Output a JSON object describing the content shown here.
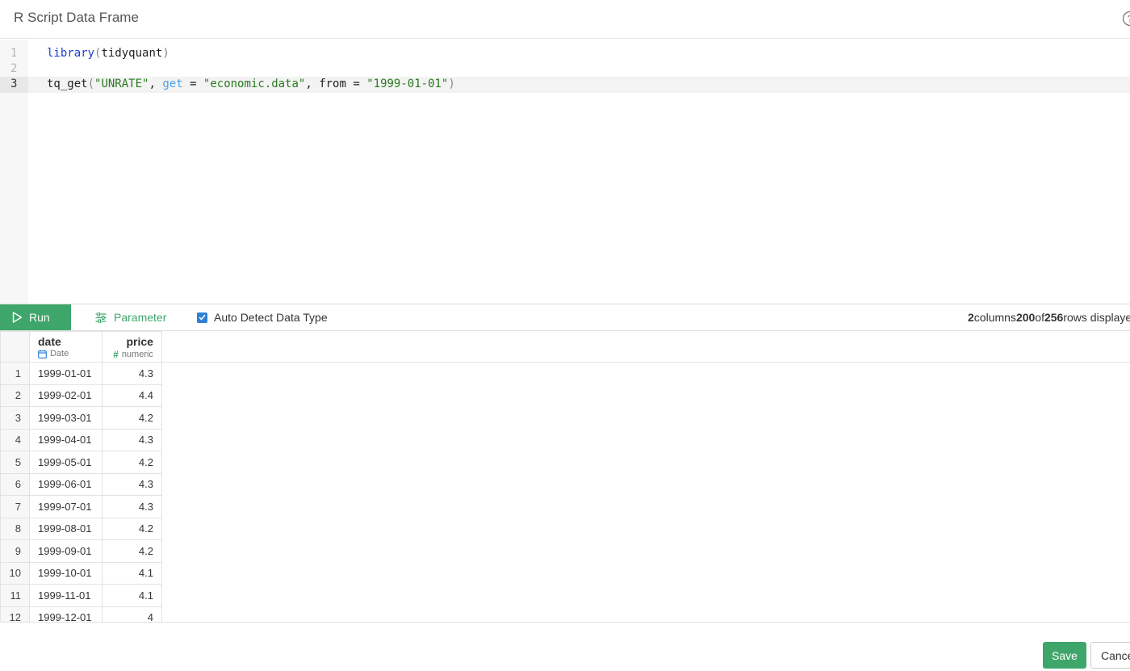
{
  "header": {
    "title": "R Script Data Frame",
    "help_icon": "help-circle-icon"
  },
  "editor": {
    "line_numbers": [
      "1",
      "2",
      "3"
    ],
    "active_line": 3,
    "line1": {
      "fn": "library",
      "open": "(",
      "arg": "tidyquant",
      "close": ")"
    },
    "line3": {
      "fn": "tq_get",
      "open": "(",
      "s1": "\"UNRATE\"",
      "c1": ", ",
      "arg1": "get",
      "eq1": " = ",
      "s2": "\"economic.data\"",
      "c2": ", ",
      "arg2": "from",
      "eq2": " = ",
      "s3": "\"1999-01-01\"",
      "close": ")"
    }
  },
  "toolbar": {
    "run_label": "Run",
    "parameter_label": "Parameter",
    "auto_detect_label": "Auto Detect Data Type",
    "auto_detect_checked": true,
    "columns_count": "2",
    "columns_word": "columns",
    "rows_shown": "200",
    "of_word": "of",
    "rows_total": "256",
    "rows_word": "rows displayed"
  },
  "table": {
    "columns": [
      {
        "name": "date",
        "type": "Date",
        "type_icon": "calendar-icon"
      },
      {
        "name": "price",
        "type": "numeric",
        "type_icon": "hash-icon"
      }
    ],
    "rows": [
      [
        "1",
        "1999-01-01",
        "4.3"
      ],
      [
        "2",
        "1999-02-01",
        "4.4"
      ],
      [
        "3",
        "1999-03-01",
        "4.2"
      ],
      [
        "4",
        "1999-04-01",
        "4.3"
      ],
      [
        "5",
        "1999-05-01",
        "4.2"
      ],
      [
        "6",
        "1999-06-01",
        "4.3"
      ],
      [
        "7",
        "1999-07-01",
        "4.3"
      ],
      [
        "8",
        "1999-08-01",
        "4.2"
      ],
      [
        "9",
        "1999-09-01",
        "4.2"
      ],
      [
        "10",
        "1999-10-01",
        "4.1"
      ],
      [
        "11",
        "1999-11-01",
        "4.1"
      ],
      [
        "12",
        "1999-12-01",
        "4"
      ]
    ]
  },
  "footer": {
    "save_label": "Save",
    "cancel_label": "Cancel"
  },
  "colors": {
    "accent": "#3fa66b",
    "checkbox": "#2f7fd6",
    "code_function": "#1a3fd1",
    "code_string": "#2a7a20",
    "code_argument": "#4a9fe8"
  }
}
